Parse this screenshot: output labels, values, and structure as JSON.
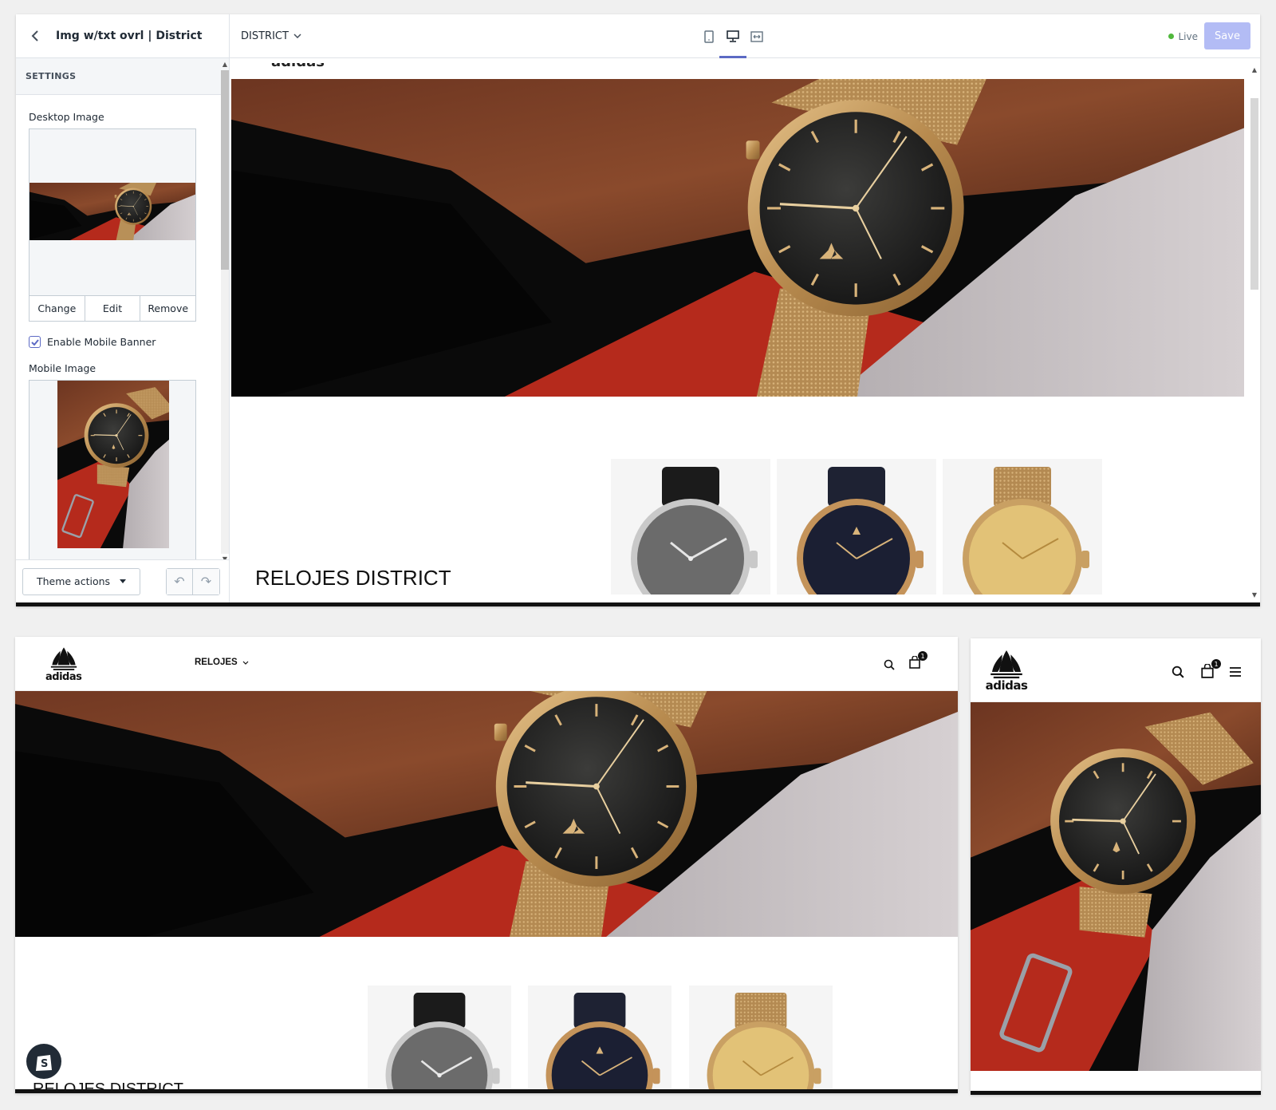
{
  "editor": {
    "sidebar": {
      "title": "Img w/txt ovrl | District",
      "section_label": "SETTINGS",
      "desktop_image_label": "Desktop Image",
      "actions": {
        "change": "Change",
        "edit": "Edit",
        "remove": "Remove"
      },
      "enable_mobile_banner": "Enable Mobile Banner",
      "enable_mobile_banner_checked": true,
      "mobile_image_label": "Mobile Image",
      "theme_actions": "Theme actions"
    },
    "topbar": {
      "theme_name": "DISTRICT",
      "live_label": "Live",
      "save_label": "Save"
    },
    "preview": {
      "cut_text": "adidas",
      "section_title": "RELOJES DISTRICT"
    }
  },
  "desktop_store": {
    "logo_text": "adidas",
    "nav_item": "RELOJES",
    "cart_count": "1",
    "section_title": "RELOJES DISTRICT"
  },
  "mobile_store": {
    "logo_text": "adidas",
    "cart_count": "1"
  },
  "colors": {
    "accent": "#5c6ac4",
    "save_disabled": "#b3bcf5",
    "live_dot": "#50b83c",
    "gold": "#c9a063",
    "sweater_red": "#b52a1c"
  },
  "icons": [
    "chevron-left-icon",
    "chevron-down-icon",
    "mobile-device-icon",
    "desktop-device-icon",
    "fullscreen-icon",
    "check-icon",
    "undo-icon",
    "redo-icon",
    "search-icon",
    "cart-icon",
    "menu-icon",
    "shopify-bag-icon",
    "adidas-trefoil-logo"
  ]
}
